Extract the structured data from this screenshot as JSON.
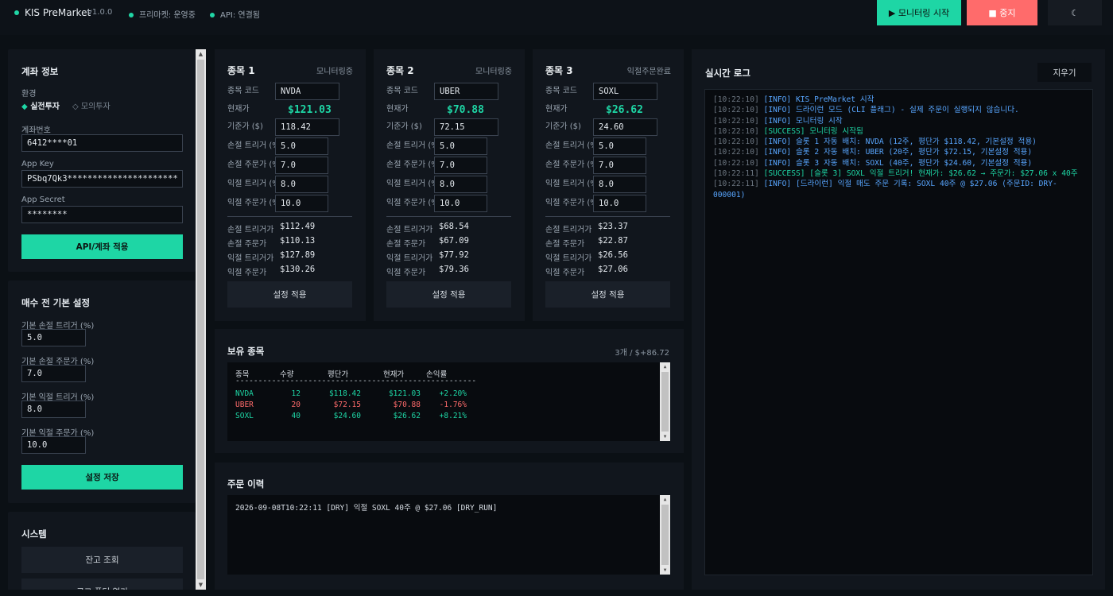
{
  "header": {
    "title": "KIS PreMarket",
    "version": "v1.0.0",
    "premarket_status": "프리마켓: 운영중",
    "api_status": "API: 연결됨",
    "start_button": "▶ 모니터링 시작",
    "stop_button": "■ 중지",
    "theme_button": "☾"
  },
  "account": {
    "title": "계좌 정보",
    "env_label": "환경",
    "env_real": "실전투자",
    "env_mock": "모의투자",
    "account_label": "계좌번호",
    "account_value": "6412****01",
    "appkey_label": "App Key",
    "appkey_value": "PSbq7Qk3**********************",
    "appsecret_label": "App Secret",
    "appsecret_value": "********",
    "apply_button": "API/계좌 적용"
  },
  "defaults": {
    "title": "매수 전 기본 설정",
    "stop_trigger_label": "기본 손절 트리거 (%)",
    "stop_trigger_value": "5.0",
    "stop_order_label": "기본 손절 주문가 (%)",
    "stop_order_value": "7.0",
    "profit_trigger_label": "기본 익절 트리거 (%)",
    "profit_trigger_value": "8.0",
    "profit_order_label": "기본 익절 주문가 (%)",
    "profit_order_value": "10.0",
    "save_button": "설정 저장"
  },
  "system": {
    "title": "시스템",
    "balance_button": "잔고 조회",
    "log_folder_button": "로그 폴더 열기"
  },
  "labels": {
    "code": "종목 코드",
    "current": "현재가",
    "base": "기준가 ($)",
    "stop_trigger": "손절 트리거 (%)",
    "stop_order": "손절 주문가 (%)",
    "profit_trigger": "익절 트리거 (%)",
    "profit_order": "익절 주문가 (%)",
    "calc_stop_trigger": "손절 트리거가",
    "calc_stop_order": "손절 주문가",
    "calc_profit_trigger": "익절 트리거가",
    "calc_profit_order": "익절 주문가",
    "apply": "설정 적용"
  },
  "slots": [
    {
      "title": "종목 1",
      "status": "모니터링중",
      "code": "NVDA",
      "price": "$121.03",
      "base": "118.42",
      "stop_trigger": "5.0",
      "stop_order": "7.0",
      "profit_trigger": "8.0",
      "profit_order": "10.0",
      "calc_stop_trigger": "$112.49",
      "calc_stop_order": "$110.13",
      "calc_profit_trigger": "$127.89",
      "calc_profit_order": "$130.26"
    },
    {
      "title": "종목 2",
      "status": "모니터링중",
      "code": "UBER",
      "price": "$70.88",
      "base": "72.15",
      "stop_trigger": "5.0",
      "stop_order": "7.0",
      "profit_trigger": "8.0",
      "profit_order": "10.0",
      "calc_stop_trigger": "$68.54",
      "calc_stop_order": "$67.09",
      "calc_profit_trigger": "$77.92",
      "calc_profit_order": "$79.36"
    },
    {
      "title": "종목 3",
      "status": "익절주문완료",
      "code": "SOXL",
      "price": "$26.62",
      "base": "24.60",
      "stop_trigger": "5.0",
      "stop_order": "7.0",
      "profit_trigger": "8.0",
      "profit_order": "10.0",
      "calc_stop_trigger": "$23.37",
      "calc_stop_order": "$22.87",
      "calc_profit_trigger": "$26.56",
      "calc_profit_order": "$27.06"
    }
  ],
  "holdings": {
    "title": "보유 종목",
    "summary": "3개 / $+86.72",
    "columns": [
      "종목",
      "수량",
      "평단가",
      "현재가",
      "손익률"
    ],
    "separator": "-----------------------------------------------------",
    "rows": [
      {
        "symbol": "NVDA",
        "qty": "12",
        "avg": "$118.42",
        "cur": "$121.03",
        "pnl": "+2.20%",
        "color": "#1ed6a5"
      },
      {
        "symbol": "UBER",
        "qty": "20",
        "avg": "$72.15",
        "cur": "$70.88",
        "pnl": "-1.76%",
        "color": "#ff6b6b"
      },
      {
        "symbol": "SOXL",
        "qty": "40",
        "avg": "$24.60",
        "cur": "$26.62",
        "pnl": "+8.21%",
        "color": "#1ed6a5"
      }
    ]
  },
  "orders": {
    "title": "주문 이력",
    "lines": [
      "2026-09-08T10:22:11 [DRY] 익절 SOXL 40주 @ $27.06 [DRY_RUN]"
    ]
  },
  "log": {
    "title": "실시간 로그",
    "clear_button": "지우기",
    "lines": [
      {
        "ts": "[10:22:10]",
        "type": "info",
        "text": "[INFO] KIS_PreMarket 시작"
      },
      {
        "ts": "[10:22:10]",
        "type": "info",
        "text": "[INFO] 드라이런 모드 (CLI 플래그) - 실제 주문이 실행되지 않습니다."
      },
      {
        "ts": "[10:22:10]",
        "type": "info",
        "text": "[INFO] 모니터링 시작"
      },
      {
        "ts": "[10:22:10]",
        "type": "succ",
        "text": "[SUCCESS] 모니터링 시작됨"
      },
      {
        "ts": "[10:22:10]",
        "type": "info",
        "text": "[INFO] 슬롯 1 자동 배치: NVDA (12주, 평단가 $118.42, 기본설정 적용)"
      },
      {
        "ts": "[10:22:10]",
        "type": "info",
        "text": "[INFO] 슬롯 2 자동 배치: UBER (20주, 평단가 $72.15, 기본설정 적용)"
      },
      {
        "ts": "[10:22:10]",
        "type": "info",
        "text": "[INFO] 슬롯 3 자동 배치: SOXL (40주, 평단가 $24.60, 기본설정 적용)"
      },
      {
        "ts": "[10:22:11]",
        "type": "succ",
        "text": "[SUCCESS] [슬롯 3] SOXL 익절 트리거! 현재가: $26.62 → 주문가: $27.06 x 40주"
      },
      {
        "ts": "[10:22:11]",
        "type": "info",
        "text": "[INFO] [드라이런] 익절 매도 주문 기록: SOXL 40주 @ $27.06 (주문ID: DRY-000001)"
      }
    ]
  },
  "colors": {
    "accent": "#1ed6a5",
    "danger": "#ff6b6b",
    "info": "#58a6ff",
    "panel": "#11161d",
    "bg": "#0b1015"
  }
}
